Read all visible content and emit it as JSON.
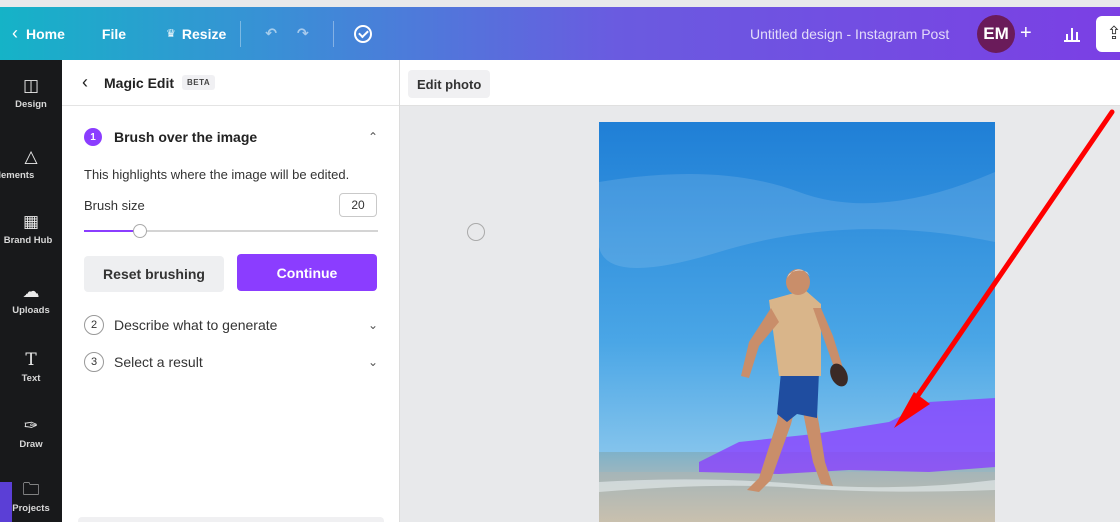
{
  "topbar": {
    "home_label": "Home",
    "file_label": "File",
    "resize_label": "Resize",
    "doc_title": "Untitled design - Instagram Post",
    "avatar_initials": "EM",
    "plus_label": "+"
  },
  "rail": {
    "items": [
      {
        "label": "Design",
        "icon": "layout-icon"
      },
      {
        "label": "Elements",
        "icon": "shapes-icon"
      },
      {
        "label": "Brand Hub",
        "icon": "brand-icon"
      },
      {
        "label": "Uploads",
        "icon": "upload-cloud-icon"
      },
      {
        "label": "Text",
        "icon": "text-icon"
      },
      {
        "label": "Draw",
        "icon": "draw-icon"
      },
      {
        "label": "Projects",
        "icon": "folder-icon"
      }
    ]
  },
  "panel": {
    "title": "Magic Edit",
    "badge": "BETA",
    "step1": {
      "number": "1",
      "title": "Brush over the image",
      "hint": "This highlights where the image will be edited.",
      "brush_label": "Brush size",
      "brush_value": "20",
      "brush_fraction": 0.19,
      "reset_label": "Reset brushing",
      "continue_label": "Continue"
    },
    "step2": {
      "number": "2",
      "title": "Describe what to generate"
    },
    "step3": {
      "number": "3",
      "title": "Select a result"
    }
  },
  "canvas": {
    "edit_photo_label": "Edit photo"
  },
  "colors": {
    "accent": "#8b3dff",
    "annotation_arrow": "#ff0000",
    "brush_overlay": "#8a3dff"
  }
}
